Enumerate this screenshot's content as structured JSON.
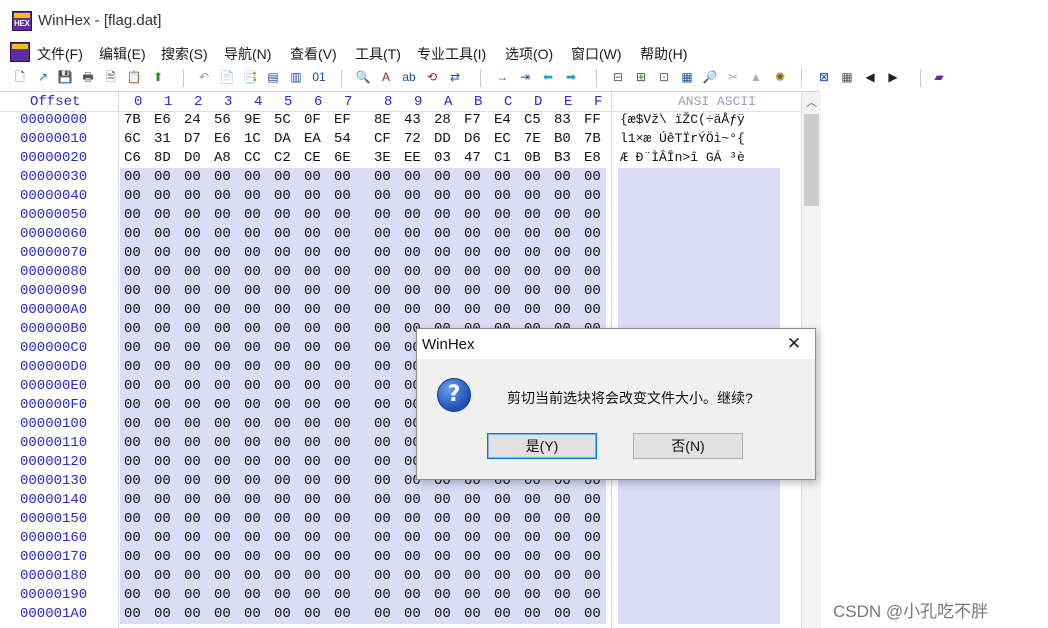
{
  "window": {
    "title": "WinHex - [flag.dat]",
    "icon_label": "HEX"
  },
  "menu": [
    "文件(F)",
    "编辑(E)",
    "搜索(S)",
    "导航(N)",
    "查看(V)",
    "工具(T)",
    "专业工具(I)",
    "选项(O)",
    "窗口(W)",
    "帮助(H)"
  ],
  "toolbar": {
    "icons": [
      "new-file-icon",
      "open-icon",
      "save-icon",
      "print-icon",
      "print-preview-icon",
      "properties-icon",
      "upload-icon",
      "undo-icon",
      "copy-icon",
      "paste-icon",
      "copy-block-icon",
      "paste-block-icon",
      "hex-binary-icon",
      "find-icon",
      "find-hex-icon",
      "find-text-icon",
      "replace-icon",
      "replace-hex-icon",
      "goto-offset-icon",
      "goto-icon",
      "back-icon",
      "forward-icon",
      "disk-icon",
      "disk-add-icon",
      "disk-tool-icon",
      "calculator-icon",
      "search-zoom-icon",
      "cut-gray-icon",
      "mountain-gray-icon",
      "settings-icon",
      "pattern-icon",
      "grid-icon",
      "previous-icon",
      "next-icon",
      "book-icon"
    ],
    "glyphs": [
      "🗋",
      "↗",
      "💾",
      "🖶",
      "🗎",
      "📋",
      "⬆",
      "↶",
      "📄",
      "📑",
      "▤",
      "▥",
      "01",
      "🔍",
      "A",
      "ab",
      "⟲",
      "⇄",
      "→",
      "⇥",
      "⬅",
      "➡",
      "⊟",
      "⊞",
      "⊡",
      "▦",
      "🔎",
      "✂",
      "▲",
      "✺",
      "⊠",
      "▦",
      "◀",
      "▶",
      "▰"
    ]
  },
  "editor": {
    "offset_header": "Offset",
    "columns": [
      "0",
      "1",
      "2",
      "3",
      "4",
      "5",
      "6",
      "7",
      "8",
      "9",
      "A",
      "B",
      "C",
      "D",
      "E",
      "F"
    ],
    "ansi_header": "ANSI ASCII",
    "rows": [
      {
        "offset": "00000000",
        "bytes": [
          "7B",
          "E6",
          "24",
          "56",
          "9E",
          "5C",
          "0F",
          "EF",
          "8E",
          "43",
          "28",
          "F7",
          "E4",
          "C5",
          "83",
          "FF"
        ],
        "ansi": "{æ$Vž\\ ïŽC(÷äÅƒÿ",
        "selected": false
      },
      {
        "offset": "00000010",
        "bytes": [
          "6C",
          "31",
          "D7",
          "E6",
          "1C",
          "DA",
          "EA",
          "54",
          "CF",
          "72",
          "DD",
          "D6",
          "EC",
          "7E",
          "B0",
          "7B"
        ],
        "ansi": "l1×æ ÚêTÏrÝÖì~°{",
        "selected": false
      },
      {
        "offset": "00000020",
        "bytes": [
          "C6",
          "8D",
          "D0",
          "A8",
          "CC",
          "C2",
          "CE",
          "6E",
          "3E",
          "EE",
          "03",
          "47",
          "C1",
          "0B",
          "B3",
          "E8"
        ],
        "ansi": "Æ Ð¨ÌÂÎn>î GÁ ³è",
        "selected": false
      },
      {
        "offset": "00000030",
        "bytes": [
          "00",
          "00",
          "00",
          "00",
          "00",
          "00",
          "00",
          "00",
          "00",
          "00",
          "00",
          "00",
          "00",
          "00",
          "00",
          "00"
        ],
        "ansi": "",
        "selected": true
      },
      {
        "offset": "00000040",
        "bytes": [
          "00",
          "00",
          "00",
          "00",
          "00",
          "00",
          "00",
          "00",
          "00",
          "00",
          "00",
          "00",
          "00",
          "00",
          "00",
          "00"
        ],
        "ansi": "",
        "selected": true
      },
      {
        "offset": "00000050",
        "bytes": [
          "00",
          "00",
          "00",
          "00",
          "00",
          "00",
          "00",
          "00",
          "00",
          "00",
          "00",
          "00",
          "00",
          "00",
          "00",
          "00"
        ],
        "ansi": "",
        "selected": true
      },
      {
        "offset": "00000060",
        "bytes": [
          "00",
          "00",
          "00",
          "00",
          "00",
          "00",
          "00",
          "00",
          "00",
          "00",
          "00",
          "00",
          "00",
          "00",
          "00",
          "00"
        ],
        "ansi": "",
        "selected": true
      },
      {
        "offset": "00000070",
        "bytes": [
          "00",
          "00",
          "00",
          "00",
          "00",
          "00",
          "00",
          "00",
          "00",
          "00",
          "00",
          "00",
          "00",
          "00",
          "00",
          "00"
        ],
        "ansi": "",
        "selected": true
      },
      {
        "offset": "00000080",
        "bytes": [
          "00",
          "00",
          "00",
          "00",
          "00",
          "00",
          "00",
          "00",
          "00",
          "00",
          "00",
          "00",
          "00",
          "00",
          "00",
          "00"
        ],
        "ansi": "",
        "selected": true
      },
      {
        "offset": "00000090",
        "bytes": [
          "00",
          "00",
          "00",
          "00",
          "00",
          "00",
          "00",
          "00",
          "00",
          "00",
          "00",
          "00",
          "00",
          "00",
          "00",
          "00"
        ],
        "ansi": "",
        "selected": true
      },
      {
        "offset": "000000A0",
        "bytes": [
          "00",
          "00",
          "00",
          "00",
          "00",
          "00",
          "00",
          "00",
          "00",
          "00",
          "00",
          "00",
          "00",
          "00",
          "00",
          "00"
        ],
        "ansi": "",
        "selected": true
      },
      {
        "offset": "000000B0",
        "bytes": [
          "00",
          "00",
          "00",
          "00",
          "00",
          "00",
          "00",
          "00",
          "00",
          "00",
          "00",
          "00",
          "00",
          "00",
          "00",
          "00"
        ],
        "ansi": "",
        "selected": true
      },
      {
        "offset": "000000C0",
        "bytes": [
          "00",
          "00",
          "00",
          "00",
          "00",
          "00",
          "00",
          "00",
          "00",
          "00",
          "00",
          "00",
          "00",
          "00",
          "00",
          "00"
        ],
        "ansi": "",
        "selected": true
      },
      {
        "offset": "000000D0",
        "bytes": [
          "00",
          "00",
          "00",
          "00",
          "00",
          "00",
          "00",
          "00",
          "00",
          "00",
          "00",
          "00",
          "00",
          "00",
          "00",
          "00"
        ],
        "ansi": "",
        "selected": true
      },
      {
        "offset": "000000E0",
        "bytes": [
          "00",
          "00",
          "00",
          "00",
          "00",
          "00",
          "00",
          "00",
          "00",
          "00",
          "00",
          "00",
          "00",
          "00",
          "00",
          "00"
        ],
        "ansi": "",
        "selected": true
      },
      {
        "offset": "000000F0",
        "bytes": [
          "00",
          "00",
          "00",
          "00",
          "00",
          "00",
          "00",
          "00",
          "00",
          "00",
          "00",
          "00",
          "00",
          "00",
          "00",
          "00"
        ],
        "ansi": "",
        "selected": true
      },
      {
        "offset": "00000100",
        "bytes": [
          "00",
          "00",
          "00",
          "00",
          "00",
          "00",
          "00",
          "00",
          "00",
          "00",
          "00",
          "00",
          "00",
          "00",
          "00",
          "00"
        ],
        "ansi": "",
        "selected": true
      },
      {
        "offset": "00000110",
        "bytes": [
          "00",
          "00",
          "00",
          "00",
          "00",
          "00",
          "00",
          "00",
          "00",
          "00",
          "00",
          "00",
          "00",
          "00",
          "00",
          "00"
        ],
        "ansi": "",
        "selected": true
      },
      {
        "offset": "00000120",
        "bytes": [
          "00",
          "00",
          "00",
          "00",
          "00",
          "00",
          "00",
          "00",
          "00",
          "00",
          "00",
          "00",
          "00",
          "00",
          "00",
          "00"
        ],
        "ansi": "",
        "selected": true
      },
      {
        "offset": "00000130",
        "bytes": [
          "00",
          "00",
          "00",
          "00",
          "00",
          "00",
          "00",
          "00",
          "00",
          "00",
          "00",
          "00",
          "00",
          "00",
          "00",
          "00"
        ],
        "ansi": "",
        "selected": true
      },
      {
        "offset": "00000140",
        "bytes": [
          "00",
          "00",
          "00",
          "00",
          "00",
          "00",
          "00",
          "00",
          "00",
          "00",
          "00",
          "00",
          "00",
          "00",
          "00",
          "00"
        ],
        "ansi": "",
        "selected": true
      },
      {
        "offset": "00000150",
        "bytes": [
          "00",
          "00",
          "00",
          "00",
          "00",
          "00",
          "00",
          "00",
          "00",
          "00",
          "00",
          "00",
          "00",
          "00",
          "00",
          "00"
        ],
        "ansi": "",
        "selected": true
      },
      {
        "offset": "00000160",
        "bytes": [
          "00",
          "00",
          "00",
          "00",
          "00",
          "00",
          "00",
          "00",
          "00",
          "00",
          "00",
          "00",
          "00",
          "00",
          "00",
          "00"
        ],
        "ansi": "",
        "selected": true
      },
      {
        "offset": "00000170",
        "bytes": [
          "00",
          "00",
          "00",
          "00",
          "00",
          "00",
          "00",
          "00",
          "00",
          "00",
          "00",
          "00",
          "00",
          "00",
          "00",
          "00"
        ],
        "ansi": "",
        "selected": true
      },
      {
        "offset": "00000180",
        "bytes": [
          "00",
          "00",
          "00",
          "00",
          "00",
          "00",
          "00",
          "00",
          "00",
          "00",
          "00",
          "00",
          "00",
          "00",
          "00",
          "00"
        ],
        "ansi": "",
        "selected": true
      },
      {
        "offset": "00000190",
        "bytes": [
          "00",
          "00",
          "00",
          "00",
          "00",
          "00",
          "00",
          "00",
          "00",
          "00",
          "00",
          "00",
          "00",
          "00",
          "00",
          "00"
        ],
        "ansi": "",
        "selected": true
      },
      {
        "offset": "000001A0",
        "bytes": [
          "00",
          "00",
          "00",
          "00",
          "00",
          "00",
          "00",
          "00",
          "00",
          "00",
          "00",
          "00",
          "00",
          "00",
          "00",
          "00"
        ],
        "ansi": "",
        "selected": true
      }
    ]
  },
  "dialog": {
    "title": "WinHex",
    "close_glyph": "✕",
    "question_glyph": "?",
    "message": "剪切当前选块将会改变文件大小。继续?",
    "yes_label": "是(Y)",
    "no_label": "否(N)"
  },
  "scrollbar": {
    "up_glyph": "︿"
  },
  "watermark": "CSDN @小孔吃不胖",
  "colors": {
    "selection": "#dcdcf7",
    "offset_blue": "#2a2ad0",
    "accent": "#0078d7"
  }
}
